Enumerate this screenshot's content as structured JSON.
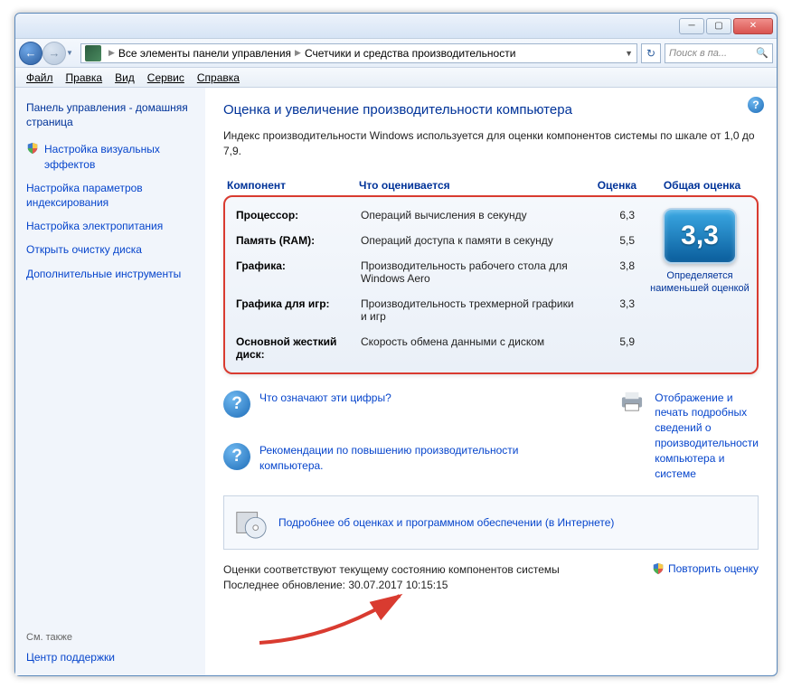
{
  "breadcrumb": {
    "item1": "Все элементы панели управления",
    "item2": "Счетчики и средства производительности"
  },
  "search": {
    "placeholder": "Поиск в па..."
  },
  "menu": {
    "file": "Файл",
    "edit": "Правка",
    "view": "Вид",
    "tools": "Сервис",
    "help": "Справка"
  },
  "sidebar": {
    "home": "Панель управления - домашняя страница",
    "links": [
      "Настройка визуальных эффектов",
      "Настройка параметров индексирования",
      "Настройка электропитания",
      "Открыть очистку диска",
      "Дополнительные инструменты"
    ],
    "see_also_hdr": "См. также",
    "see_also_link": "Центр поддержки"
  },
  "main": {
    "title": "Оценка и увеличение производительности компьютера",
    "intro": "Индекс производительности Windows используется для оценки компонентов системы по шкале от 1,0 до 7,9.",
    "headers": {
      "component": "Компонент",
      "desc": "Что оценивается",
      "score": "Оценка",
      "base": "Общая оценка"
    },
    "rows": [
      {
        "comp": "Процессор:",
        "desc": "Операций вычисления в секунду",
        "score": "6,3"
      },
      {
        "comp": "Память (RAM):",
        "desc": "Операций доступа к памяти в секунду",
        "score": "5,5"
      },
      {
        "comp": "Графика:",
        "desc": "Производительность рабочего стола для Windows Aero",
        "score": "3,8"
      },
      {
        "comp": "Графика для игр:",
        "desc": "Производительность трехмерной графики и игр",
        "score": "3,3"
      },
      {
        "comp": "Основной жесткий диск:",
        "desc": "Скорость обмена данными с диском",
        "score": "5,9"
      }
    ],
    "base_score": "3,3",
    "base_caption": "Определяется наименьшей оценкой",
    "info_links": {
      "what": "Что означают эти цифры?",
      "tips": "Рекомендации по повышению производительности компьютера.",
      "print": "Отображение и печать подробных сведений о производительности компьютера и системе"
    },
    "detail_link": "Подробнее об оценках и программном обеспечении (в Интернете)",
    "footer_line1": "Оценки соответствуют текущему состоянию компонентов системы",
    "footer_line2": "Последнее обновление: 30.07.2017 10:15:15",
    "rerun": "Повторить оценку"
  }
}
